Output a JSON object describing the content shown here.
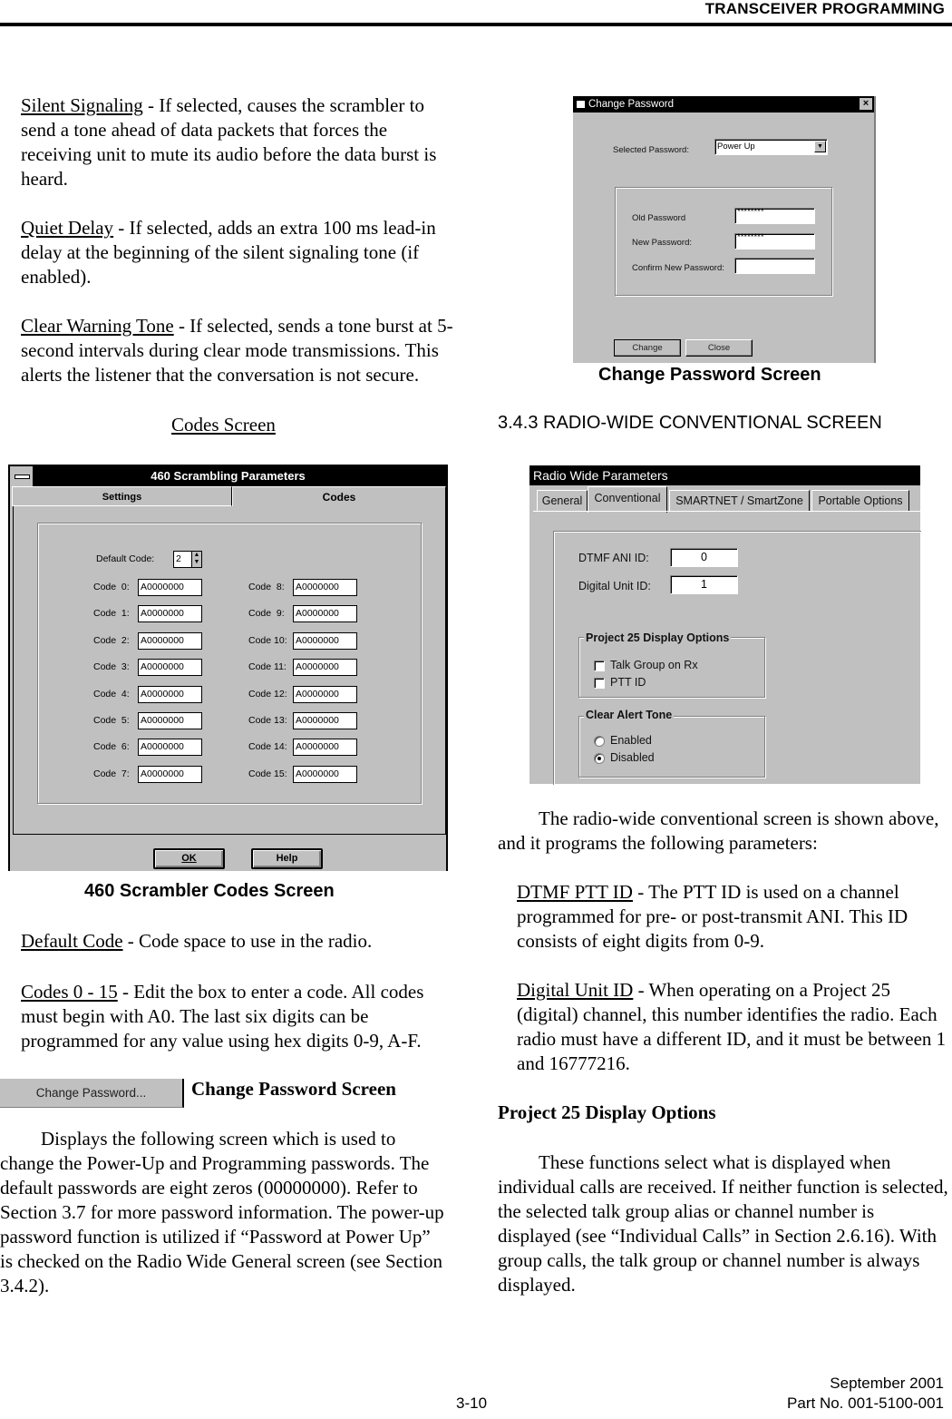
{
  "header": {
    "title": "TRANSCEIVER PROGRAMMING"
  },
  "left_column": {
    "silent_signaling": {
      "term": "Silent Signaling",
      "text": " - If selected, causes the scrambler to send a tone ahead of data packets that forces the receiving unit to mute its audio before the data burst is heard."
    },
    "quiet_delay": {
      "term": "Quiet Delay",
      "text": " - If selected, adds an extra 100 ms lead-in delay at the beginning of the silent signaling tone (if enabled)."
    },
    "clear_warning_tone": {
      "term": "Clear Warning Tone",
      "text": " - If selected, sends a tone burst at 5-second intervals during clear mode transmissions. This alerts the listener that the conversation is not secure."
    },
    "codes_screen_heading": "Codes Screen",
    "scrambler_caption": "460 Scrambler Codes Screen",
    "default_code": {
      "term": "Default Code",
      "text": " - Code space to use in the radio."
    },
    "codes_0_15": {
      "term": "Codes 0 - 15",
      "text": " - Edit the box to enter a code. All codes must begin with A0. The last six digits can be programmed for any value using hex digits 0-9, A-F."
    },
    "change_password_button": "Change Password...",
    "change_password_heading": "Change Password Screen",
    "change_password_text": "Displays the following screen which is used to change the Power-Up and Programming passwords. The default passwords are eight zeros (00000000). Refer to Section 3.7 for more password information. The power-up password function is utilized if “Password at Power Up” is checked on the Radio Wide General screen (see Section 3.4.2)."
  },
  "scrambler_dialog": {
    "title": "460 Scrambling Parameters",
    "tabs": [
      {
        "label": "Settings",
        "active": false
      },
      {
        "label": "Codes",
        "active": true
      }
    ],
    "default_code_label": "Default Code:",
    "default_code_value": "2",
    "codes_left": [
      {
        "label": "Code  0:",
        "value": "A0000000"
      },
      {
        "label": "Code  1:",
        "value": "A0000000"
      },
      {
        "label": "Code  2:",
        "value": "A0000000"
      },
      {
        "label": "Code  3:",
        "value": "A0000000"
      },
      {
        "label": "Code  4:",
        "value": "A0000000"
      },
      {
        "label": "Code  5:",
        "value": "A0000000"
      },
      {
        "label": "Code  6:",
        "value": "A0000000"
      },
      {
        "label": "Code  7:",
        "value": "A0000000"
      }
    ],
    "codes_right": [
      {
        "label": "Code  8:",
        "value": "A0000000"
      },
      {
        "label": "Code  9:",
        "value": "A0000000"
      },
      {
        "label": "Code 10:",
        "value": "A0000000"
      },
      {
        "label": "Code 11:",
        "value": "A0000000"
      },
      {
        "label": "Code 12:",
        "value": "A0000000"
      },
      {
        "label": "Code 13:",
        "value": "A0000000"
      },
      {
        "label": "Code 14:",
        "value": "A0000000"
      },
      {
        "label": "Code 15:",
        "value": "A0000000"
      }
    ],
    "ok_label": "OK",
    "help_label": "Help"
  },
  "password_dialog": {
    "title": "Change Password",
    "selected_password_label": "Selected Password:",
    "selected_password_value": "Power Up",
    "old_password_label": "Old Password",
    "old_password_value": "********",
    "new_password_label": "New Password:",
    "new_password_value": "********",
    "confirm_label": "Confirm New Password:",
    "confirm_value": "",
    "change_label": "Change",
    "close_label": "Close",
    "caption": "Change Password Screen"
  },
  "right_column": {
    "section_heading": "3.4.3 RADIO-WIDE CONVENTIONAL SCREEN",
    "intro": "The radio-wide conventional screen is shown above, and it programs the following parameters:",
    "dtmf_ptt_id": {
      "term": "DTMF PTT ID",
      "text": " - The PTT ID is used on a channel programmed for pre- or post-transmit ANI. This ID consists of eight digits from 0-9."
    },
    "digital_unit_id": {
      "term": "Digital Unit ID",
      "text": " - When operating on a Project 25 (digital) channel, this number identifies the radio. Each radio must have a different ID, and it must be between 1 and 16777216."
    },
    "p25_heading": "Project 25 Display Options",
    "p25_text": "These functions select what is displayed when individual calls are received. If neither function is selected, the selected talk group alias or channel number is displayed (see “Individual Calls” in Section 2.6.16). With group calls, the talk group or channel number is always displayed."
  },
  "radio_wide_dialog": {
    "title": "Radio Wide Parameters",
    "tabs": [
      {
        "label": "General",
        "active": false
      },
      {
        "label": "Conventional",
        "active": true
      },
      {
        "label": "SMARTNET / SmartZone",
        "active": false
      },
      {
        "label": "Portable Options",
        "active": false
      }
    ],
    "dtmf_ani_label": "DTMF ANI ID:",
    "dtmf_ani_value": "0",
    "digital_unit_label": "Digital Unit ID:",
    "digital_unit_value": "1",
    "p25_group_title": "Project 25 Display Options",
    "p25_options": [
      {
        "label": "Talk Group on Rx",
        "checked": false
      },
      {
        "label": "PTT ID",
        "checked": false
      }
    ],
    "alert_group_title": "Clear Alert Tone",
    "alert_options": [
      {
        "label": "Enabled",
        "selected": false
      },
      {
        "label": "Disabled",
        "selected": true
      }
    ]
  },
  "footer": {
    "page_number": "3-10",
    "date": "September 2001",
    "part_no": "Part No. 001-5100-001"
  }
}
